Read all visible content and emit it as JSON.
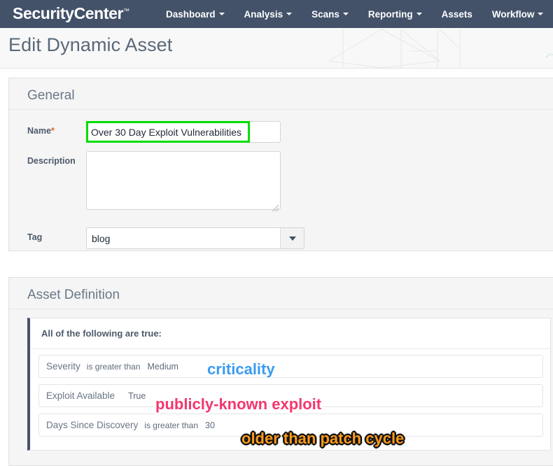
{
  "brand": {
    "name": "SecurityCenter",
    "trademark": "™"
  },
  "nav": {
    "items": [
      {
        "label": "Dashboard",
        "has_caret": true
      },
      {
        "label": "Analysis",
        "has_caret": true
      },
      {
        "label": "Scans",
        "has_caret": true
      },
      {
        "label": "Reporting",
        "has_caret": true
      },
      {
        "label": "Assets",
        "has_caret": false
      },
      {
        "label": "Workflow",
        "has_caret": true
      }
    ]
  },
  "page": {
    "title": "Edit Dynamic Asset"
  },
  "general": {
    "heading": "General",
    "name_label": "Name",
    "name_required_marker": "*",
    "name_value": "Over 30 Day Exploit Vulnerabilities",
    "description_label": "Description",
    "description_value": "",
    "description_placeholder": "",
    "tag_label": "Tag",
    "tag_value": "blog"
  },
  "asset_definition": {
    "heading": "Asset Definition",
    "rules_header": "All of the following are true:",
    "rules": [
      {
        "field": "Severity",
        "operator": "is greater than",
        "value": "Medium"
      },
      {
        "field": "Exploit Available",
        "operator": "",
        "value": "True"
      },
      {
        "field": "Days Since Discovery",
        "operator": "is greater than",
        "value": "30"
      }
    ]
  },
  "annotations": [
    {
      "text": "criticality",
      "color": "#3b9cf0"
    },
    {
      "text": "publicly-known exploit",
      "color": "#f4376d"
    },
    {
      "text": "older than patch cycle",
      "color": "#fb9a1b"
    }
  ],
  "colors": {
    "navbar": "#435269",
    "panel_bg": "#f5f5f5",
    "accent_rule_border": "#44536b",
    "highlight_green": "#00dd00",
    "required_marker": "#e8622c"
  }
}
